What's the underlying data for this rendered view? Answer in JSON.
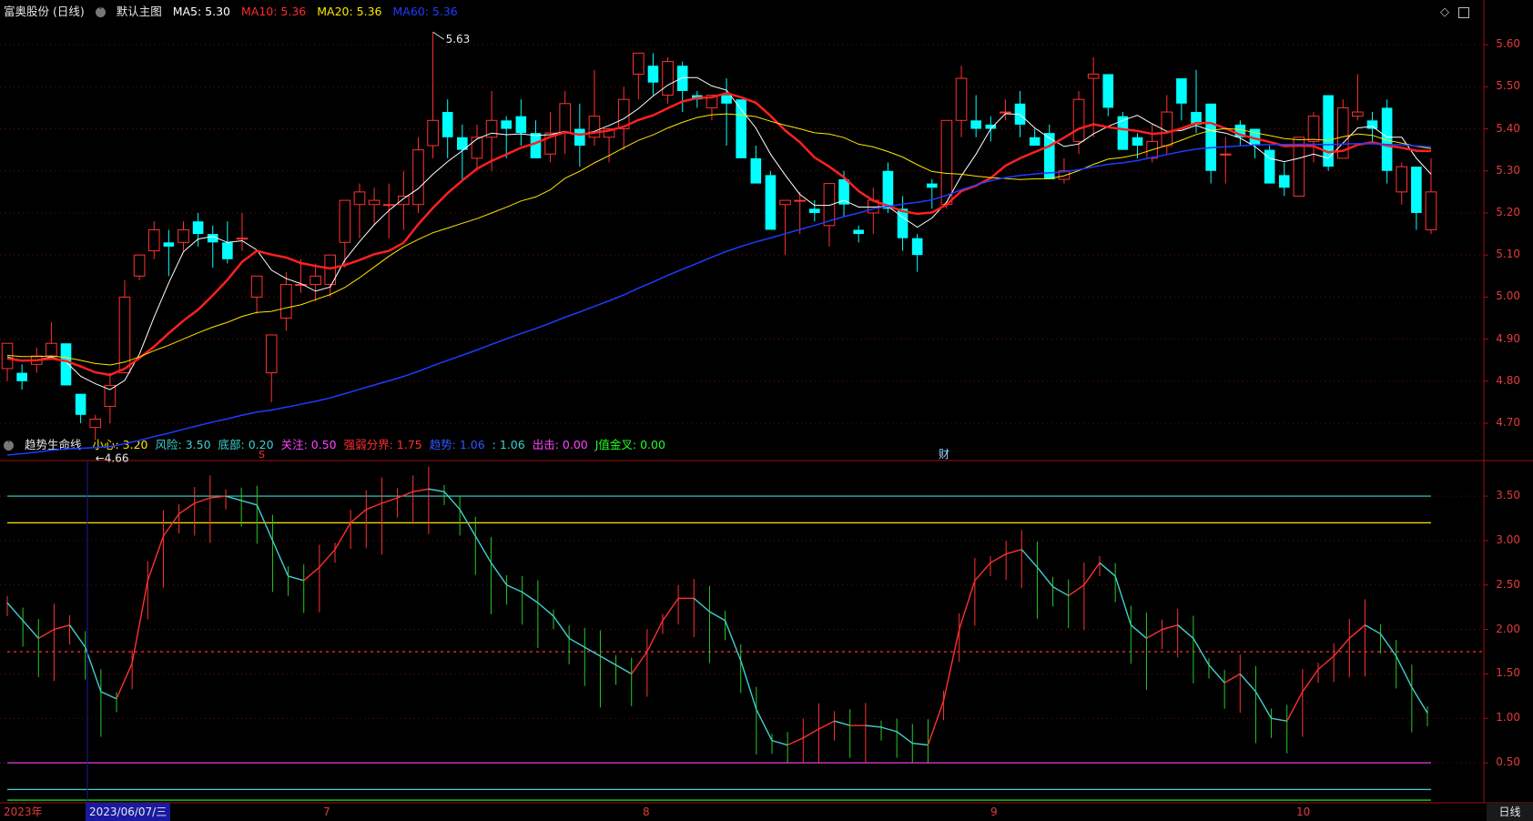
{
  "stock": {
    "name": "富奥股份 (日线)",
    "main_chart_label": "默认主图",
    "ma": [
      {
        "label": "MA5: 5.30",
        "color": "#ffffff"
      },
      {
        "label": "MA10: 5.36",
        "color": "#ff2a2a"
      },
      {
        "label": "MA20: 5.36",
        "color": "#ffe600"
      },
      {
        "label": "MA60: 5.36",
        "color": "#1f3cff"
      }
    ]
  },
  "indicator": {
    "name": "趋势生命线",
    "params": [
      {
        "label": "小心: 3.20",
        "color": "#ffe600"
      },
      {
        "label": "风险: 3.50",
        "color": "#3fd0d0"
      },
      {
        "label": "底部: 0.20",
        "color": "#3fd0d0"
      },
      {
        "label": "关注: 0.50",
        "color": "#ff44ff"
      },
      {
        "label": "强弱分界: 1.75",
        "color": "#ff3030"
      },
      {
        "label": "趋势: 1.06",
        "color": "#3355ff"
      },
      {
        "label": ": 1.06",
        "color": "#3fd0d0"
      },
      {
        "label": "出击: 0.00",
        "color": "#ff44ff"
      },
      {
        "label": "J值金叉: 0.00",
        "color": "#22ff22"
      }
    ]
  },
  "annotations": {
    "high_label": "5.63",
    "low_label": "←4.66",
    "s_marker": "S",
    "cai_marker": "财"
  },
  "x_axis": {
    "year": "2023年",
    "cursor_date": "2023/06/07/三",
    "months": [
      "7",
      "8",
      "9",
      "10"
    ],
    "period_button": "日线"
  },
  "chart_data": [
    {
      "type": "candlestick",
      "title": "富奥股份 (日线)",
      "ylim": [
        4.62,
        5.65
      ],
      "y_ticks": [
        "5.60",
        "5.50",
        "5.40",
        "5.30",
        "5.20",
        "5.10",
        "5.00",
        "4.90",
        "4.80",
        "4.70"
      ],
      "ohlc": [
        [
          4.83,
          4.89,
          4.8,
          4.89
        ],
        [
          4.82,
          4.84,
          4.78,
          4.8
        ],
        [
          4.84,
          4.88,
          4.82,
          4.86
        ],
        [
          4.86,
          4.94,
          4.85,
          4.89
        ],
        [
          4.89,
          4.89,
          4.8,
          4.79
        ],
        [
          4.77,
          4.77,
          4.7,
          4.72
        ],
        [
          4.69,
          4.72,
          4.66,
          4.71
        ],
        [
          4.74,
          4.82,
          4.7,
          4.79
        ],
        [
          4.82,
          5.04,
          4.82,
          5.0
        ],
        [
          5.05,
          5.1,
          5.04,
          5.1
        ],
        [
          5.11,
          5.18,
          5.09,
          5.16
        ],
        [
          5.13,
          5.16,
          5.05,
          5.12
        ],
        [
          5.13,
          5.18,
          5.11,
          5.16
        ],
        [
          5.18,
          5.2,
          5.12,
          5.15
        ],
        [
          5.15,
          5.17,
          5.07,
          5.13
        ],
        [
          5.13,
          5.18,
          5.08,
          5.09
        ],
        [
          5.14,
          5.2,
          5.11,
          5.14
        ],
        [
          5.0,
          5.05,
          4.96,
          5.05
        ],
        [
          4.82,
          4.91,
          4.75,
          4.91
        ],
        [
          4.95,
          5.06,
          4.92,
          5.03
        ],
        [
          5.03,
          5.09,
          5.01,
          5.03
        ],
        [
          5.03,
          5.08,
          4.99,
          5.05
        ],
        [
          5.03,
          5.1,
          5.0,
          5.1
        ],
        [
          5.13,
          5.23,
          5.07,
          5.23
        ],
        [
          5.22,
          5.27,
          5.14,
          5.25
        ],
        [
          5.22,
          5.26,
          5.17,
          5.23
        ],
        [
          5.22,
          5.27,
          5.14,
          5.22
        ],
        [
          5.22,
          5.3,
          5.16,
          5.24
        ],
        [
          5.22,
          5.38,
          5.2,
          5.35
        ],
        [
          5.36,
          5.63,
          5.33,
          5.42
        ],
        [
          5.44,
          5.47,
          5.33,
          5.38
        ],
        [
          5.38,
          5.41,
          5.28,
          5.35
        ],
        [
          5.33,
          5.41,
          5.3,
          5.38
        ],
        [
          5.38,
          5.49,
          5.3,
          5.42
        ],
        [
          5.42,
          5.43,
          5.33,
          5.4
        ],
        [
          5.43,
          5.47,
          5.36,
          5.39
        ],
        [
          5.39,
          5.42,
          5.33,
          5.33
        ],
        [
          5.34,
          5.44,
          5.32,
          5.39
        ],
        [
          5.39,
          5.49,
          5.34,
          5.46
        ],
        [
          5.4,
          5.46,
          5.31,
          5.36
        ],
        [
          5.38,
          5.54,
          5.36,
          5.43
        ],
        [
          5.38,
          5.4,
          5.32,
          5.4
        ],
        [
          5.4,
          5.5,
          5.35,
          5.47
        ],
        [
          5.53,
          5.58,
          5.47,
          5.58
        ],
        [
          5.55,
          5.58,
          5.48,
          5.51
        ],
        [
          5.48,
          5.57,
          5.46,
          5.56
        ],
        [
          5.55,
          5.56,
          5.44,
          5.49
        ],
        [
          5.48,
          5.49,
          5.45,
          5.47
        ],
        [
          5.45,
          5.48,
          5.42,
          5.48
        ],
        [
          5.48,
          5.52,
          5.36,
          5.46
        ],
        [
          5.47,
          5.47,
          5.33,
          5.33
        ],
        [
          5.33,
          5.36,
          5.27,
          5.27
        ],
        [
          5.29,
          5.3,
          5.16,
          5.16
        ],
        [
          5.22,
          5.23,
          5.1,
          5.23
        ],
        [
          5.23,
          5.25,
          5.15,
          5.23
        ],
        [
          5.21,
          5.23,
          5.18,
          5.2
        ],
        [
          5.17,
          5.24,
          5.12,
          5.27
        ],
        [
          5.28,
          5.3,
          5.19,
          5.22
        ],
        [
          5.16,
          5.17,
          5.13,
          5.15
        ],
        [
          5.2,
          5.26,
          5.15,
          5.23
        ],
        [
          5.3,
          5.32,
          5.2,
          5.21
        ],
        [
          5.21,
          5.24,
          5.11,
          5.14
        ],
        [
          5.14,
          5.15,
          5.06,
          5.1
        ],
        [
          5.27,
          5.28,
          5.21,
          5.26
        ],
        [
          5.22,
          5.31,
          5.21,
          5.42
        ],
        [
          5.42,
          5.55,
          5.38,
          5.52
        ],
        [
          5.42,
          5.48,
          5.38,
          5.4
        ],
        [
          5.41,
          5.43,
          5.37,
          5.4
        ],
        [
          5.44,
          5.47,
          5.42,
          5.44
        ],
        [
          5.46,
          5.49,
          5.38,
          5.41
        ],
        [
          5.38,
          5.4,
          5.36,
          5.36
        ],
        [
          5.39,
          5.41,
          5.28,
          5.28
        ],
        [
          5.28,
          5.33,
          5.27,
          5.3
        ],
        [
          5.37,
          5.49,
          5.34,
          5.47
        ],
        [
          5.52,
          5.57,
          5.38,
          5.53
        ],
        [
          5.53,
          5.53,
          5.43,
          5.45
        ],
        [
          5.43,
          5.44,
          5.35,
          5.35
        ],
        [
          5.38,
          5.39,
          5.33,
          5.36
        ],
        [
          5.33,
          5.41,
          5.32,
          5.37
        ],
        [
          5.36,
          5.48,
          5.34,
          5.44
        ],
        [
          5.52,
          5.52,
          5.42,
          5.46
        ],
        [
          5.44,
          5.54,
          5.39,
          5.41
        ],
        [
          5.46,
          5.46,
          5.27,
          5.3
        ],
        [
          5.34,
          5.38,
          5.27,
          5.34
        ],
        [
          5.41,
          5.42,
          5.36,
          5.38
        ],
        [
          5.4,
          5.4,
          5.33,
          5.36
        ],
        [
          5.35,
          5.36,
          5.27,
          5.27
        ],
        [
          5.29,
          5.32,
          5.24,
          5.26
        ],
        [
          5.24,
          5.38,
          5.24,
          5.38
        ],
        [
          5.37,
          5.44,
          5.32,
          5.43
        ],
        [
          5.48,
          5.48,
          5.3,
          5.31
        ],
        [
          5.33,
          5.47,
          5.33,
          5.45
        ],
        [
          5.43,
          5.53,
          5.42,
          5.44
        ],
        [
          5.42,
          5.44,
          5.37,
          5.4
        ],
        [
          5.45,
          5.47,
          5.27,
          5.3
        ],
        [
          5.25,
          5.32,
          5.22,
          5.31
        ],
        [
          5.31,
          5.31,
          5.16,
          5.2
        ],
        [
          5.16,
          5.33,
          5.15,
          5.25
        ]
      ],
      "ma_overlays": "MA5 white, MA10 red, MA20 yellow, MA60 blue"
    },
    {
      "type": "line",
      "title": "趋势生命线",
      "ylim": [
        0.05,
        3.9
      ],
      "y_ticks": [
        "3.50",
        "3.00",
        "2.50",
        "2.00",
        "1.50",
        "1.00",
        "0.50"
      ],
      "hlines": [
        {
          "y": 3.5,
          "color": "#3fd0d0"
        },
        {
          "y": 3.2,
          "color": "#ffe600"
        },
        {
          "y": 1.75,
          "color": "#ff3030",
          "dashed": true
        },
        {
          "y": 0.5,
          "color": "#ff44ff"
        },
        {
          "y": 0.2,
          "color": "#3fd0d0"
        },
        {
          "y": 0.08,
          "color": "#22ff22"
        }
      ],
      "trend": [
        2.3,
        2.1,
        1.9,
        2.0,
        2.05,
        1.8,
        1.3,
        1.22,
        1.62,
        2.55,
        3.05,
        3.3,
        3.42,
        3.48,
        3.5,
        3.45,
        3.4,
        3.0,
        2.6,
        2.55,
        2.7,
        2.9,
        3.2,
        3.35,
        3.42,
        3.48,
        3.55,
        3.58,
        3.55,
        3.35,
        3.05,
        2.75,
        2.5,
        2.42,
        2.3,
        2.15,
        1.9,
        1.8,
        1.7,
        1.6,
        1.5,
        1.75,
        2.1,
        2.35,
        2.35,
        2.2,
        2.1,
        1.65,
        1.1,
        0.75,
        0.7,
        0.78,
        0.88,
        0.97,
        0.92,
        0.92,
        0.9,
        0.85,
        0.72,
        0.7,
        1.2,
        2.0,
        2.55,
        2.75,
        2.85,
        2.9,
        2.7,
        2.48,
        2.38,
        2.5,
        2.75,
        2.6,
        2.05,
        1.9,
        2.0,
        2.05,
        1.9,
        1.6,
        1.4,
        1.5,
        1.3,
        1.0,
        0.97,
        1.3,
        1.55,
        1.7,
        1.9,
        2.05,
        1.95,
        1.7,
        1.35,
        1.06
      ]
    }
  ]
}
